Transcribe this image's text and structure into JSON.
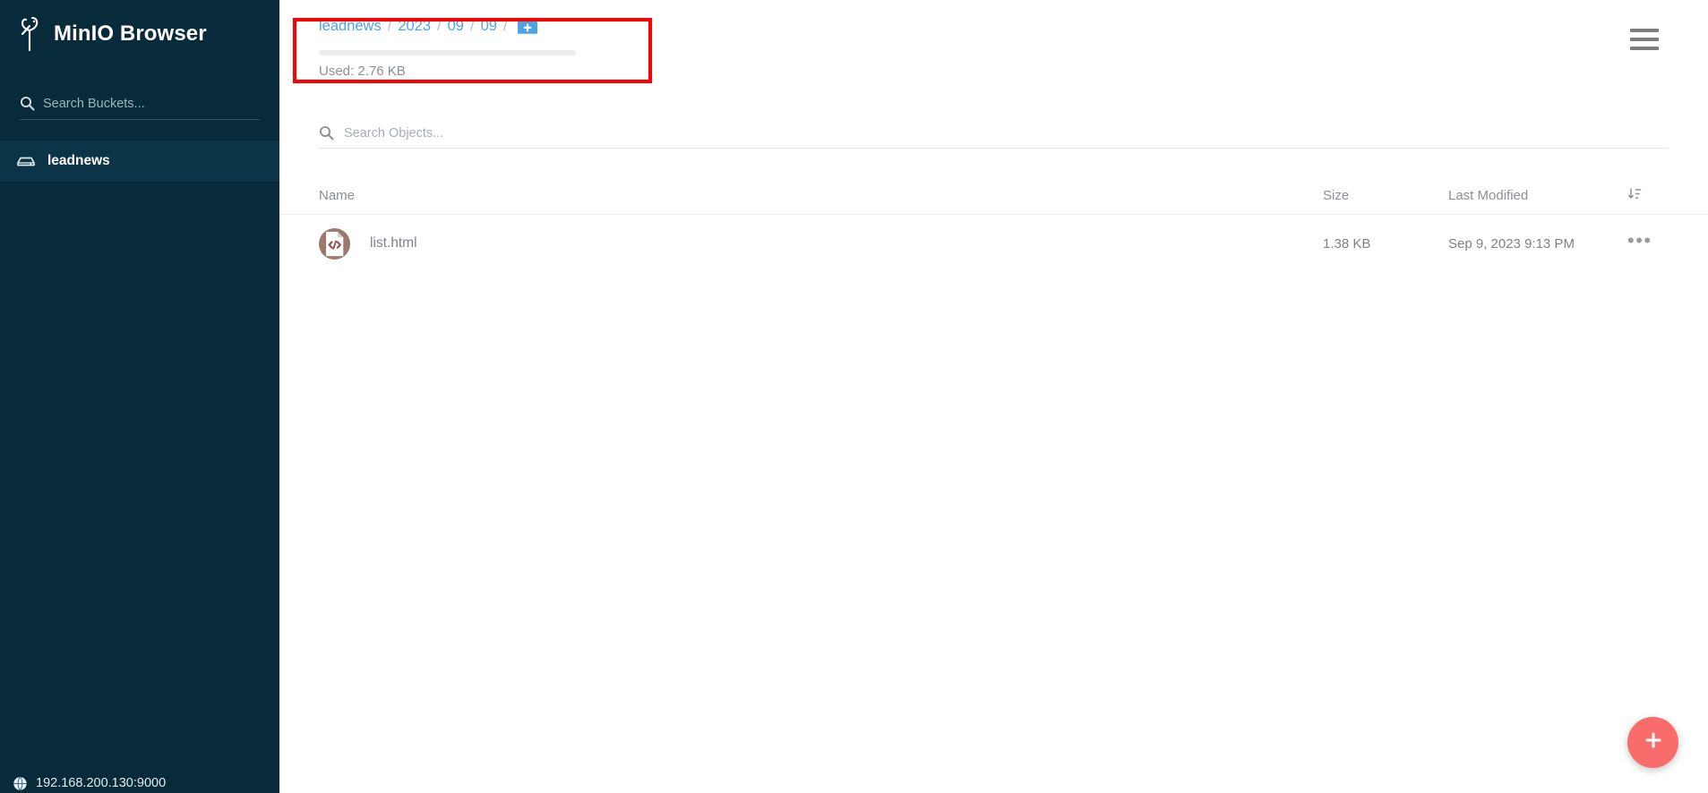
{
  "sidebar": {
    "brand": {
      "logo_icon": "minio-flamingo-logo",
      "title": "MinIO Browser"
    },
    "search": {
      "icon": "search-icon",
      "placeholder": "Search Buckets...",
      "value": ""
    },
    "buckets": [
      {
        "label": "leadnews",
        "icon": "bucket-icon",
        "active": true
      }
    ],
    "footer": {
      "icon": "globe-icon",
      "host": "192.168.200.130:9000"
    }
  },
  "topbar": {
    "breadcrumb": {
      "crumbs": [
        "leadnews",
        "2023",
        "09",
        "09"
      ],
      "separator": "/",
      "new_folder_icon": "folder-plus-icon"
    },
    "usage": {
      "bar_percent": 4,
      "label": "Used: 2.76 KB"
    },
    "menu_icon": "hamburger-menu-icon"
  },
  "object_search": {
    "icon": "search-icon",
    "placeholder": "Search Objects...",
    "value": ""
  },
  "object_table": {
    "columns": {
      "name": "Name",
      "size": "Size",
      "last_modified": "Last Modified",
      "sort_icon": "sort-icon"
    },
    "rows": [
      {
        "icon": "html-file-icon",
        "name": "list.html",
        "size": "1.38 KB",
        "last_modified": "Sep 9, 2023 9:13 PM",
        "menu": "•••"
      }
    ]
  },
  "fab": {
    "icon": "plus-icon",
    "color": "#f86d6b"
  },
  "annotation": {
    "type": "highlight-box",
    "color": "#fd0000"
  },
  "colors": {
    "sidebar_bg": "#072b3b",
    "sidebar_active": "#0b3446",
    "link_blue": "#4fa3e3",
    "folder_blue": "#4fa3e3",
    "file_avatar": "#9a7a68",
    "fab": "#f86d6b",
    "annotation_red": "#fd0000"
  }
}
